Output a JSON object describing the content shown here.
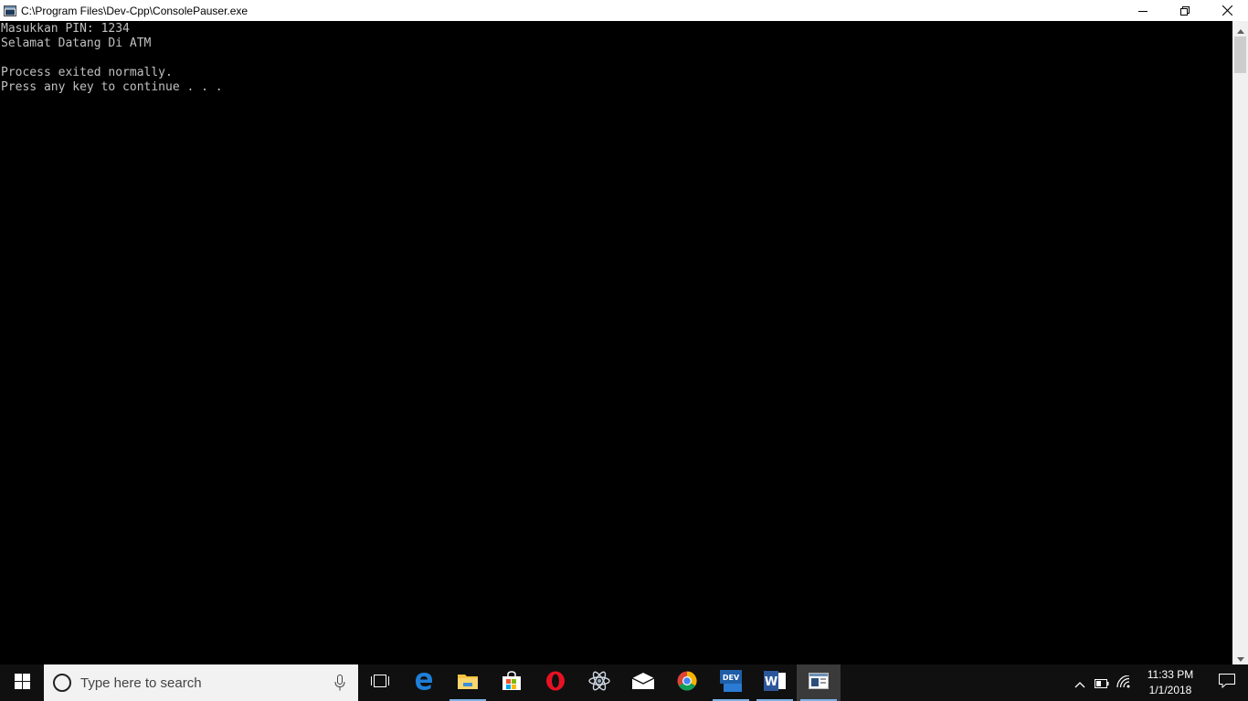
{
  "window": {
    "title": "C:\\Program Files\\Dev-Cpp\\ConsolePauser.exe",
    "icon": "console-app-icon",
    "controls": [
      "minimize-icon",
      "restore-icon",
      "close-icon"
    ]
  },
  "console": {
    "text_color": "#c0c0c0",
    "background": "#000000",
    "lines": [
      "Masukkan PIN: 1234",
      "Selamat Datang Di ATM",
      "",
      "Process exited normally.",
      "Press any key to continue . . ."
    ]
  },
  "taskbar": {
    "search_placeholder": "Type here to search",
    "pinned": [
      {
        "name": "task-view",
        "icon": "task-view-icon"
      },
      {
        "name": "edge",
        "icon": "edge-icon",
        "color": "#1e7fd8"
      },
      {
        "name": "file-explorer",
        "icon": "folder-icon",
        "color": "#f6c342",
        "running": true
      },
      {
        "name": "store",
        "icon": "store-icon"
      },
      {
        "name": "opera",
        "icon": "opera-icon",
        "color": "#e81123"
      },
      {
        "name": "atom",
        "icon": "atom-icon"
      },
      {
        "name": "mail",
        "icon": "mail-icon"
      },
      {
        "name": "chrome",
        "icon": "chrome-icon"
      },
      {
        "name": "dev-cpp",
        "icon": "dev-cpp-icon",
        "label": "DEV",
        "running": true
      },
      {
        "name": "word",
        "icon": "word-icon",
        "label": "W",
        "running": true
      },
      {
        "name": "console-pauser",
        "icon": "console-app-icon",
        "running": true,
        "active": true
      }
    ],
    "tray": {
      "icons": [
        "chevron-up-icon",
        "battery-icon",
        "wifi-icon"
      ],
      "time": "11:33 PM",
      "date": "1/1/2018",
      "notification_icon": "notification-icon"
    }
  }
}
